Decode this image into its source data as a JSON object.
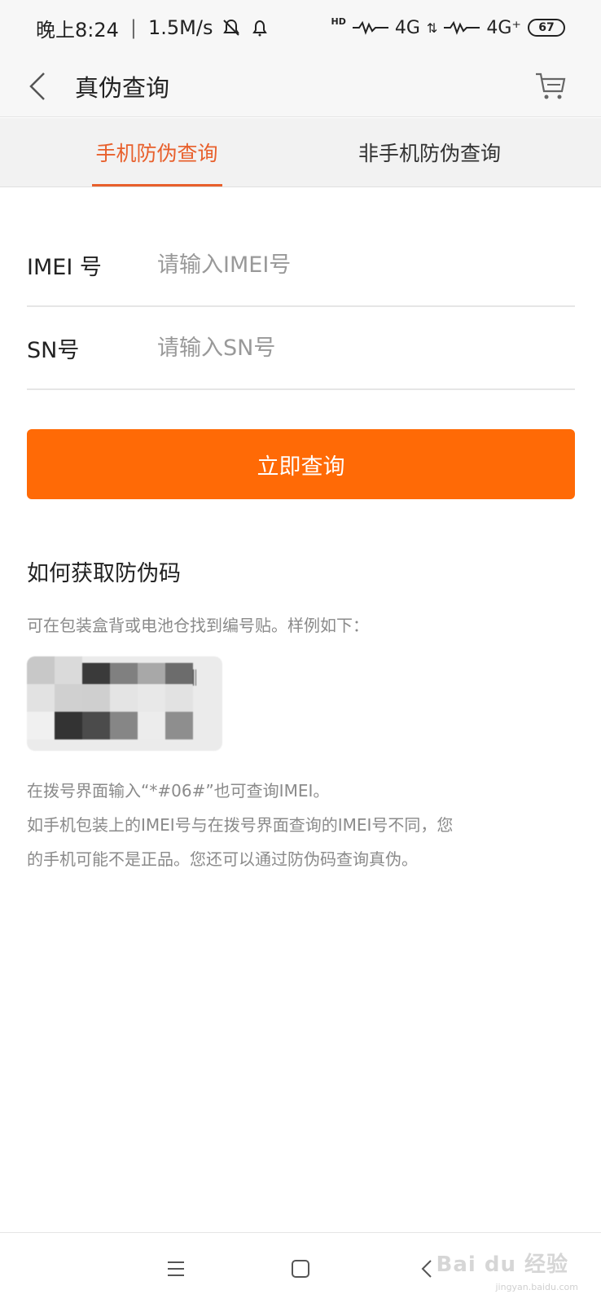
{
  "status_bar": {
    "time": "晚上8:24",
    "speed": "1.5M/s",
    "network_1": "4G",
    "network_2": "4G⁺",
    "hd": "HD",
    "battery": "67"
  },
  "header": {
    "title": "真伪查询"
  },
  "tabs": [
    {
      "label": "手机防伪查询",
      "active": true
    },
    {
      "label": "非手机防伪查询",
      "active": false
    }
  ],
  "form": {
    "imei_label": "IMEI 号",
    "imei_placeholder": "请输入IMEI号",
    "sn_label": "SN号",
    "sn_placeholder": "请输入SN号"
  },
  "query_button": "立即查询",
  "help": {
    "title": "如何获取防伪码",
    "subtitle": "可在包装盒背或电池仓找到编号贴。样例如下：",
    "note_line1": "在拨号界面输入“*#06#”也可查询IMEI。",
    "note_line2": "如手机包装上的IMEI号与在拨号界面查询的IMEI号不同，您",
    "note_line3": "的手机可能不是正品。您还可以通过防伪码查询真伪。"
  },
  "watermark": {
    "logo": "Bai du 经验",
    "url": "jingyan.baidu.com"
  },
  "colors": {
    "accent": "#ff6a06",
    "tab_active": "#e8602c"
  }
}
